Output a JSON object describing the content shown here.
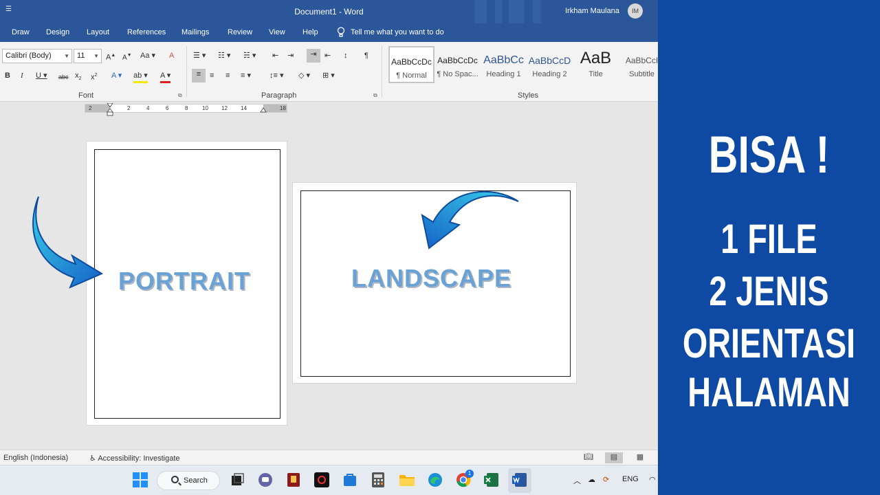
{
  "window": {
    "title": "Document1  -  Word",
    "user_name": "Irkham Maulana",
    "user_initials": "IM",
    "qat_glyph": "☰"
  },
  "tabs": [
    "Draw",
    "Design",
    "Layout",
    "References",
    "Mailings",
    "Review",
    "View",
    "Help"
  ],
  "tell_me": "Tell me what you want to do",
  "font": {
    "family": "Calibri (Body)",
    "size": "11",
    "group_label": "Font"
  },
  "paragraph": {
    "group_label": "Paragraph"
  },
  "styles": {
    "group_label": "Styles",
    "items": [
      {
        "preview": "AaBbCcDc",
        "name": "¶ Normal"
      },
      {
        "preview": "AaBbCcDc",
        "name": "¶ No Spac..."
      },
      {
        "preview": "AaBbCc",
        "name": "Heading 1"
      },
      {
        "preview": "AaBbCcD",
        "name": "Heading 2"
      },
      {
        "preview": "AaB",
        "name": "Title"
      },
      {
        "preview": "AaBbCcI",
        "name": "Subtitle"
      }
    ]
  },
  "ruler": [
    "2",
    "2",
    "4",
    "6",
    "8",
    "10",
    "12",
    "14",
    "18"
  ],
  "pages": {
    "portrait_label": "PORTRAIT",
    "landscape_label": "LANDSCAPE"
  },
  "status": {
    "language": "English (Indonesia)",
    "accessibility": "Accessibility: Investigate"
  },
  "taskbar": {
    "search_label": "Search",
    "lang": "ENG",
    "badge": "1"
  },
  "promo": {
    "line1": "BISA !",
    "line2": "1 FILE",
    "line3": "2 JENIS",
    "line4": "ORIENTASI",
    "line5": "HALAMAN"
  },
  "colors": {
    "title_bar": "#2b579a",
    "promo_bg": "#0e4aa3",
    "orientation_text": "#6aa2d6",
    "arrow_light": "#38d0e8",
    "arrow_dark": "#1662c8"
  }
}
